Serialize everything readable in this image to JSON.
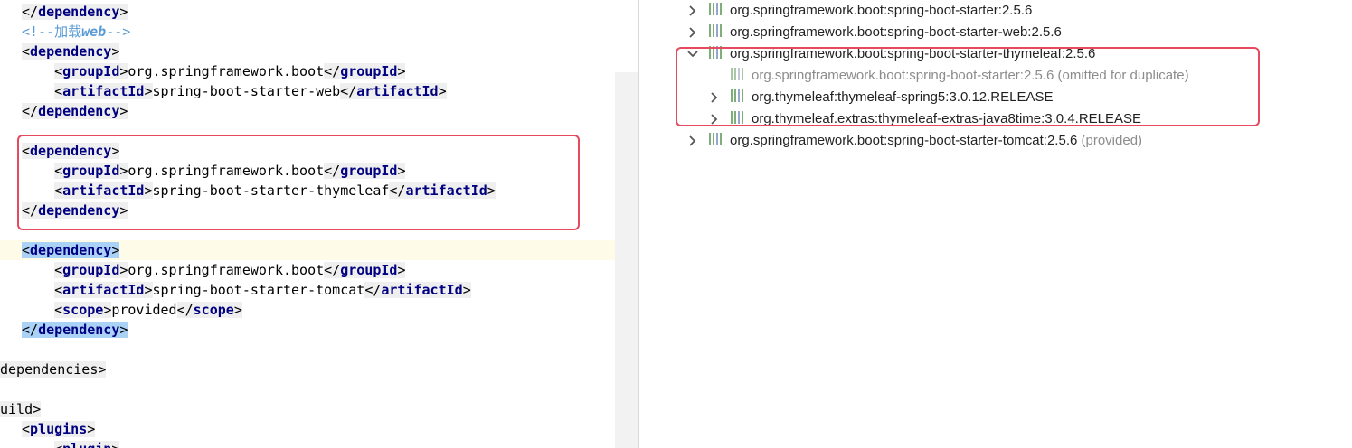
{
  "editor": {
    "lines": [
      {
        "key": "l0",
        "html": "<span class=\"bg\">&lt;/<span class=\"tag\">dependency</span>&gt;</span>"
      },
      {
        "key": "l1",
        "html": "<span class=\"cmt\">&lt;!--加载<i>web</i>--&gt;</span>"
      },
      {
        "key": "l2",
        "html": "<span class=\"bg\">&lt;<span class=\"tag\">dependency</span>&gt;</span>"
      },
      {
        "key": "l3",
        "html": "    <span class=\"bg\">&lt;<span class=\"tag\">groupId</span>&gt;</span>org.springframework.boot<span class=\"bg\">&lt;/<span class=\"tag\">groupId</span>&gt;</span>"
      },
      {
        "key": "l4",
        "html": "    <span class=\"bg\">&lt;<span class=\"tag\">artifactId</span>&gt;</span>spring-boot-starter-web<span class=\"bg\">&lt;/<span class=\"tag\">artifactId</span>&gt;</span>"
      },
      {
        "key": "l5",
        "html": "<span class=\"bg\">&lt;/<span class=\"tag\">dependency</span>&gt;</span>"
      },
      {
        "key": "l6",
        "html": ""
      },
      {
        "key": "l7",
        "html": "<span class=\"bg\">&lt;<span class=\"tag\">dependency</span>&gt;</span>"
      },
      {
        "key": "l8",
        "html": "    <span class=\"bg\">&lt;<span class=\"tag\">groupId</span>&gt;</span>org.springframework.boot<span class=\"bg\">&lt;/<span class=\"tag\">groupId</span>&gt;</span>"
      },
      {
        "key": "l9",
        "html": "    <span class=\"bg\">&lt;<span class=\"tag\">artifactId</span>&gt;</span>spring-boot-starter-thymeleaf<span class=\"bg\">&lt;/<span class=\"tag\">artifactId</span>&gt;</span>"
      },
      {
        "key": "l10",
        "html": "<span class=\"bg\">&lt;/<span class=\"tag\">dependency</span>&gt;</span>"
      },
      {
        "key": "l11",
        "html": ""
      },
      {
        "key": "l12",
        "html": "<span class=\"sel\">&lt;<span class=\"tag\">dependency</span>&gt;</span>"
      },
      {
        "key": "l13",
        "html": "    <span class=\"bg\">&lt;<span class=\"tag\">groupId</span>&gt;</span>org.springframework.boot<span class=\"bg\">&lt;/<span class=\"tag\">groupId</span>&gt;</span>"
      },
      {
        "key": "l14",
        "html": "    <span class=\"bg\">&lt;<span class=\"tag\">artifactId</span>&gt;</span>spring-boot-starter-tomcat<span class=\"bg\">&lt;/<span class=\"tag\">artifactId</span>&gt;</span>"
      },
      {
        "key": "l15",
        "html": "    <span class=\"bg\">&lt;<span class=\"tag\">scope</span>&gt;</span>provided<span class=\"bg\">&lt;/<span class=\"tag\">scope</span>&gt;</span>"
      },
      {
        "key": "l16",
        "html": "<span class=\"sel\">&lt;/<span class=\"tag\">dependency</span>&gt;</span>"
      },
      {
        "key": "l17",
        "html": ""
      },
      {
        "key": "l18",
        "html": "<span class=\"bg\">dependencies&gt;</span>"
      },
      {
        "key": "l19",
        "html": ""
      },
      {
        "key": "l20",
        "html": "<span class=\"bg\">uild&gt;</span>"
      },
      {
        "key": "l21",
        "html": "<span class=\"bg\">&lt;<span class=\"tag\">plugins</span>&gt;</span>"
      },
      {
        "key": "l22",
        "html": "    <span class=\"bg\">&lt;<span class=\"tag\">plugin</span>&gt;</span>"
      }
    ]
  },
  "tree": {
    "nodes": [
      {
        "key": "n0",
        "chevron": ">",
        "text": "org.springframework.boot:spring-boot-starter:2.5.6",
        "suffix": "",
        "dim": false
      },
      {
        "key": "n1",
        "chevron": ">",
        "text": "org.springframework.boot:spring-boot-starter-web:2.5.6",
        "suffix": "",
        "dim": false
      },
      {
        "key": "n2",
        "chevron": "v",
        "text": "org.springframework.boot:spring-boot-starter-thymeleaf:2.5.6",
        "suffix": "",
        "dim": false
      },
      {
        "key": "n3",
        "chevron": "",
        "text": "org.springframework.boot:spring-boot-starter:2.5.6",
        "suffix": " (omitted for duplicate)",
        "dim": true
      },
      {
        "key": "n4",
        "chevron": ">",
        "text": "org.thymeleaf:thymeleaf-spring5:3.0.12.RELEASE",
        "suffix": "",
        "dim": false
      },
      {
        "key": "n5",
        "chevron": ">",
        "text": "org.thymeleaf.extras:thymeleaf-extras-java8time:3.0.4.RELEASE",
        "suffix": "",
        "dim": false
      },
      {
        "key": "n6",
        "chevron": ">",
        "text": "org.springframework.boot:spring-boot-starter-tomcat:2.5.6",
        "suffix": " (provided)",
        "dim": false
      }
    ]
  }
}
